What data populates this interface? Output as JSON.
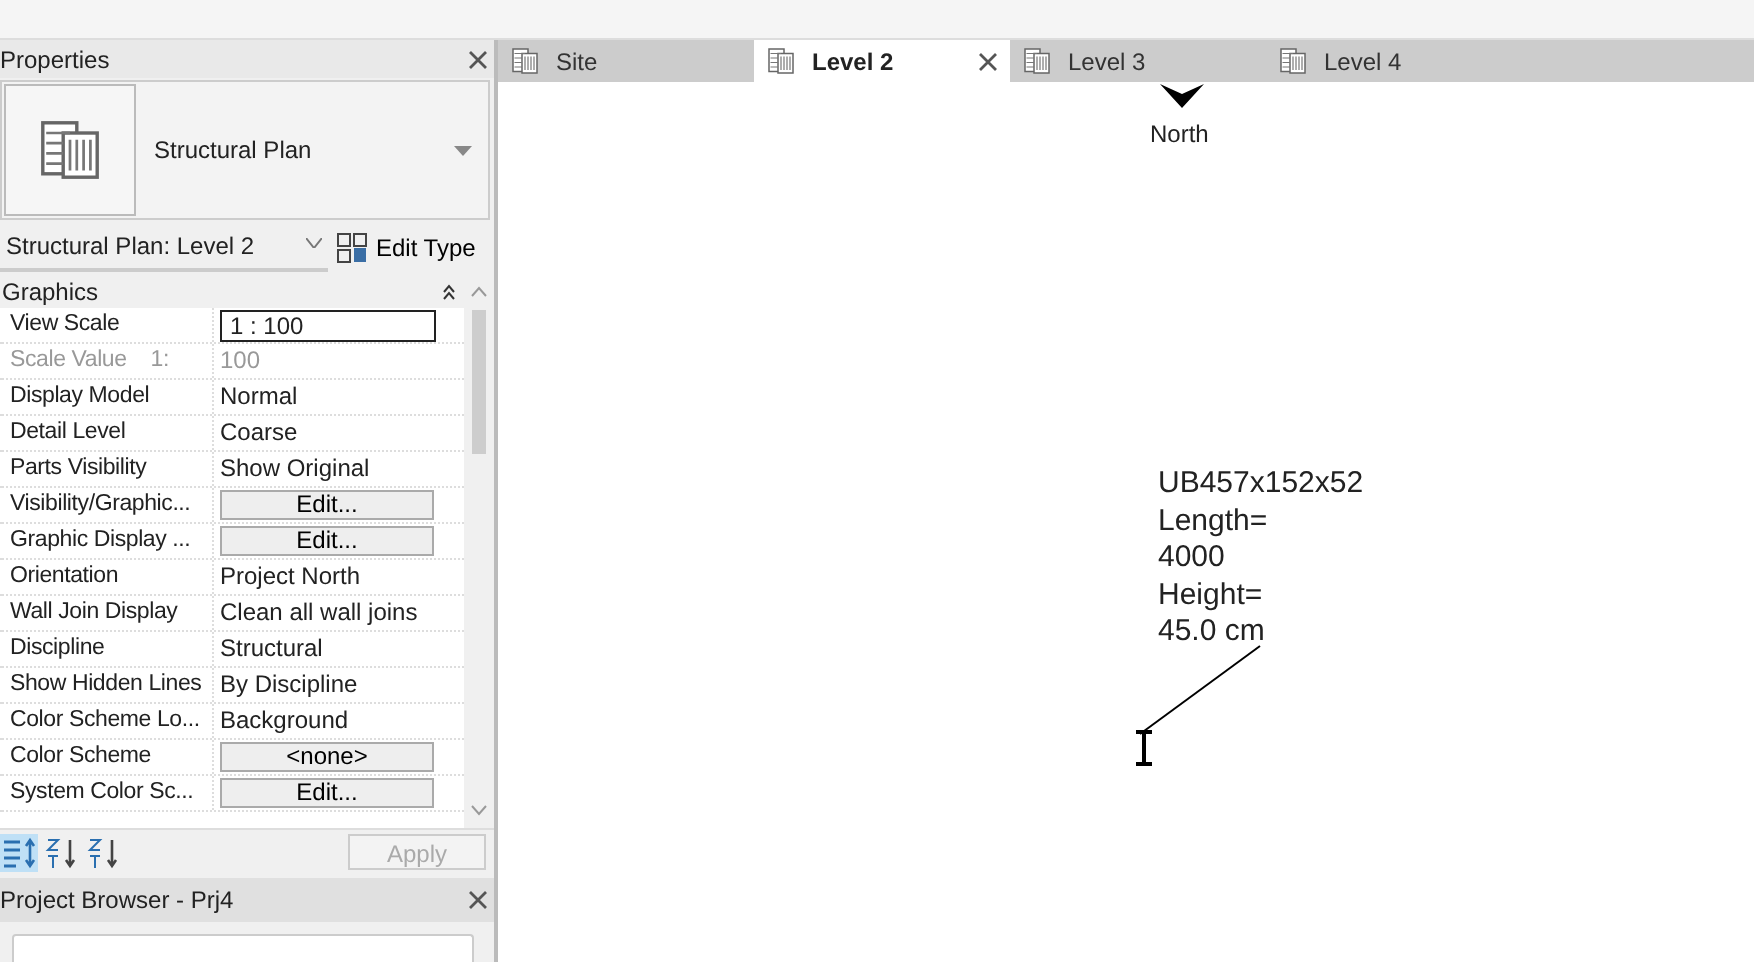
{
  "properties": {
    "title": "Properties",
    "type_name": "Structural Plan",
    "instance": "Structural Plan: Level 2",
    "edit_type": "Edit Type",
    "group": "Graphics",
    "expanded": true,
    "rows": [
      {
        "name": "View Scale",
        "value": "1 : 100",
        "kind": "field"
      },
      {
        "name": "Scale Value    1:",
        "value": "100",
        "kind": "disabled"
      },
      {
        "name": "Display Model",
        "value": "Normal",
        "kind": "text"
      },
      {
        "name": "Detail Level",
        "value": "Coarse",
        "kind": "text"
      },
      {
        "name": "Parts Visibility",
        "value": "Show Original",
        "kind": "text"
      },
      {
        "name": "Visibility/Graphic...",
        "value": "Edit...",
        "kind": "button"
      },
      {
        "name": "Graphic Display ...",
        "value": "Edit...",
        "kind": "button"
      },
      {
        "name": "Orientation",
        "value": "Project North",
        "kind": "text"
      },
      {
        "name": "Wall Join Display",
        "value": "Clean all wall joins",
        "kind": "text"
      },
      {
        "name": "Discipline",
        "value": "Structural",
        "kind": "text"
      },
      {
        "name": "Show Hidden Lines",
        "value": "By Discipline",
        "kind": "text"
      },
      {
        "name": "Color Scheme Lo...",
        "value": "Background",
        "kind": "text"
      },
      {
        "name": "Color Scheme",
        "value": "<none>",
        "kind": "button"
      },
      {
        "name": "System Color Sc...",
        "value": "Edit...",
        "kind": "button"
      }
    ],
    "sort_buttons": [
      {
        "selected": true
      },
      {
        "selected": false
      },
      {
        "selected": false
      }
    ],
    "apply": {
      "label": "Apply",
      "disabled": true
    }
  },
  "project_browser": {
    "title": "Project Browser - Prj4"
  },
  "tabs": [
    {
      "label": "Site",
      "selected": false
    },
    {
      "label": "Level 2",
      "selected": true
    },
    {
      "label": "Level 3",
      "selected": false
    },
    {
      "label": "Level 4",
      "selected": false
    }
  ],
  "canvas": {
    "north_label": "North",
    "tag_lines": [
      "UB457x152x52",
      "Length=",
      "4000",
      "Height=",
      "45.0 cm"
    ]
  }
}
